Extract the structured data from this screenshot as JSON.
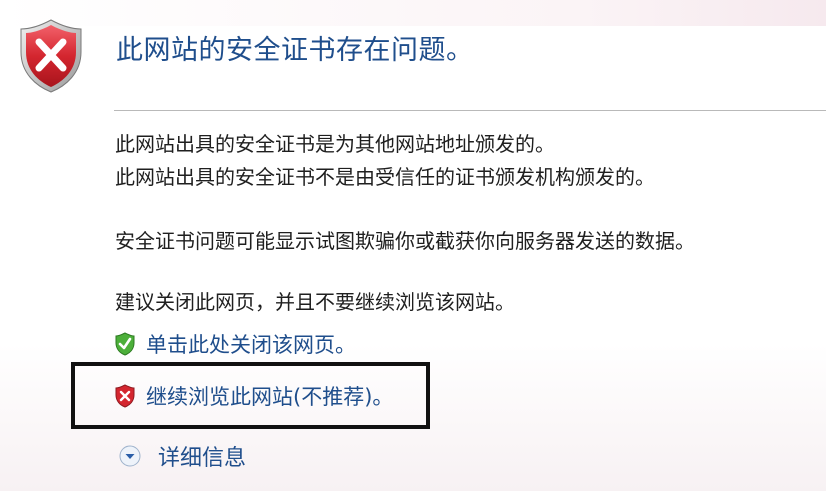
{
  "page": {
    "title": "此网站的安全证书存在问题。"
  },
  "body": {
    "line1": "此网站出具的安全证书是为其他网站地址颁发的。",
    "line2": "此网站出具的安全证书不是由受信任的证书颁发机构颁发的。",
    "line3": "安全证书问题可能显示试图欺骗你或截获你向服务器发送的数据。",
    "line4": "建议关闭此网页，并且不要继续浏览该网站。"
  },
  "options": {
    "close_label": "单击此处关闭该网页。",
    "continue_label": "继续浏览此网站(不推荐)。",
    "details_label": "详细信息"
  },
  "icons": {
    "header": "error-shield-icon",
    "close": "green-check-shield-icon",
    "continue": "red-x-shield-icon",
    "details": "chevron-down-circle-icon"
  },
  "colors": {
    "link": "#1f4e8c",
    "error_red": "#c8202a",
    "ok_green": "#3a9a2c"
  }
}
